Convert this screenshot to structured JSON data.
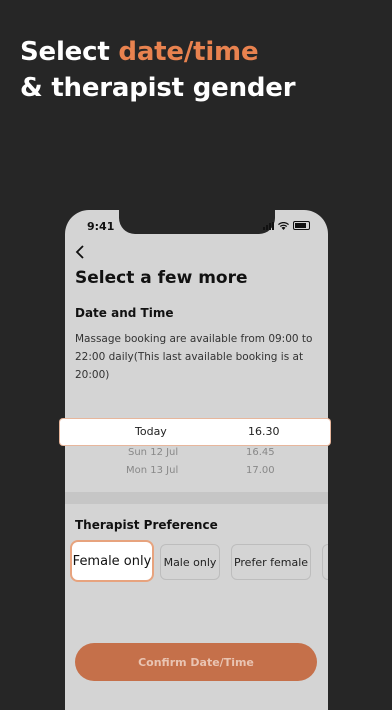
{
  "headline": {
    "line1_plain": "Select ",
    "line1_accent": "date/time",
    "line2": "& therapist gender"
  },
  "status": {
    "time": "9:41"
  },
  "page": {
    "back_icon": "chevron-left-icon",
    "title": "Select a few more",
    "date_time_heading": "Date and Time",
    "description": "Massage booking are available from 09:00 to 22:00 daily(This last available booking is at 20:00)"
  },
  "picker": {
    "selected": {
      "day": "Today",
      "time": "16.30"
    },
    "rows": [
      {
        "day": "Sun 12 Jul",
        "time": "16.45"
      },
      {
        "day": "Mon 13 Jul",
        "time": "17.00"
      }
    ]
  },
  "preference": {
    "heading": "Therapist Preference",
    "options": [
      "Female only",
      "Male only",
      "Prefer female"
    ],
    "selected": "Female only"
  },
  "confirm_label": "Confirm Date/Time",
  "colors": {
    "accent": "#e8824f",
    "button": "#c5704a",
    "background": "#262626"
  }
}
